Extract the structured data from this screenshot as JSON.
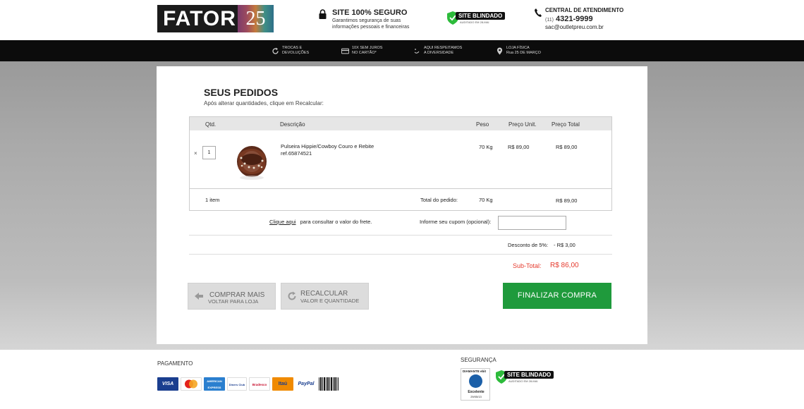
{
  "header": {
    "logo_text": "FATOR",
    "logo_number": "25",
    "secure_title": "SITE 100% SEGURO",
    "secure_text": "Garantimos segurança de suas informações pessoais e financeiras",
    "badge_text": "SITE BLINDADO",
    "badge_sub": "AUDITADO EM 28-MAI",
    "contact_title": "CENTRAL DE ATENDIMENTO",
    "contact_ddd": "(11)",
    "contact_phone": "4321-9999",
    "contact_email": "sac@outletpreu.com.br"
  },
  "nav": [
    {
      "icon": "refresh-icon",
      "line1": "TROCAS E",
      "line2": "DEVOLUÇÕES"
    },
    {
      "icon": "credit-card-icon",
      "line1": "10X SEM JUROS",
      "line2": "NO CARTÃO*"
    },
    {
      "icon": "smile-icon",
      "line1": "AQUI RESPEITAMOS",
      "line2": "A DIVERSIDADE"
    },
    {
      "icon": "map-pin-icon",
      "line1": "LOJA FÍSICA",
      "line2": "Rua 25 DE MARÇO"
    }
  ],
  "cart": {
    "title": "SEUS PEDIDOS",
    "subtitle": "Após alterar quantidades, clique em Recalcular:",
    "columns": {
      "qty": "Qtd.",
      "desc": "Descrição",
      "weight": "Peso",
      "unit": "Preço Unit.",
      "total": "Preço Total"
    },
    "item": {
      "remove": "×",
      "qty": "1",
      "name": "Pulseira Hippie/Cowboy Couro e Rebite",
      "ref": "ref.65874521",
      "weight": "70 Kg",
      "unit_price": "R$ 89,00",
      "total_price": "R$ 89,00"
    },
    "footer": {
      "items": "1 item",
      "total_label": "Total do pedido:",
      "total_weight": "70 Kg",
      "total_price": "R$ 89,00"
    },
    "frete_link": "Clique aqui",
    "frete_text": "para consultar o valor do frete.",
    "cupom_label": "Informe seu cupom (opcional):",
    "cupom_value": "",
    "discount_label": "Desconto de 5%:",
    "discount_value": "- R$ 3,00",
    "subtotal_label": "Sub-Total:",
    "subtotal_value": "R$ 86,00"
  },
  "buttons": {
    "comprar_line1": "COMPRAR MAIS",
    "comprar_line2": "VOLTAR PARA LOJA",
    "recalc_line1": "RECALCULAR",
    "recalc_line2": "VALOR E QUANTIDADE",
    "finalizar": "FINALIZAR COMPRA"
  },
  "footer": {
    "payment_title": "PAGAMENTO",
    "payment_methods": [
      "VISA",
      "MasterCard",
      "AMERICAN EXPRESS",
      "Diners Club",
      "Bradesco",
      "Itaú",
      "PayPal",
      "Boleto"
    ],
    "security_title": "SEGURANÇA",
    "ebit_top": "DIAMANTE ebit",
    "ebit_rating": "Excelente",
    "ebit_date": "29/05/13",
    "badge_text": "SITE BLINDADO",
    "badge_sub": "AUDITADO EM 28-MAI"
  },
  "colors": {
    "accent_green": "#1f9a3c",
    "price_red": "#e53b2e",
    "nav_black": "#0c0c0c"
  }
}
